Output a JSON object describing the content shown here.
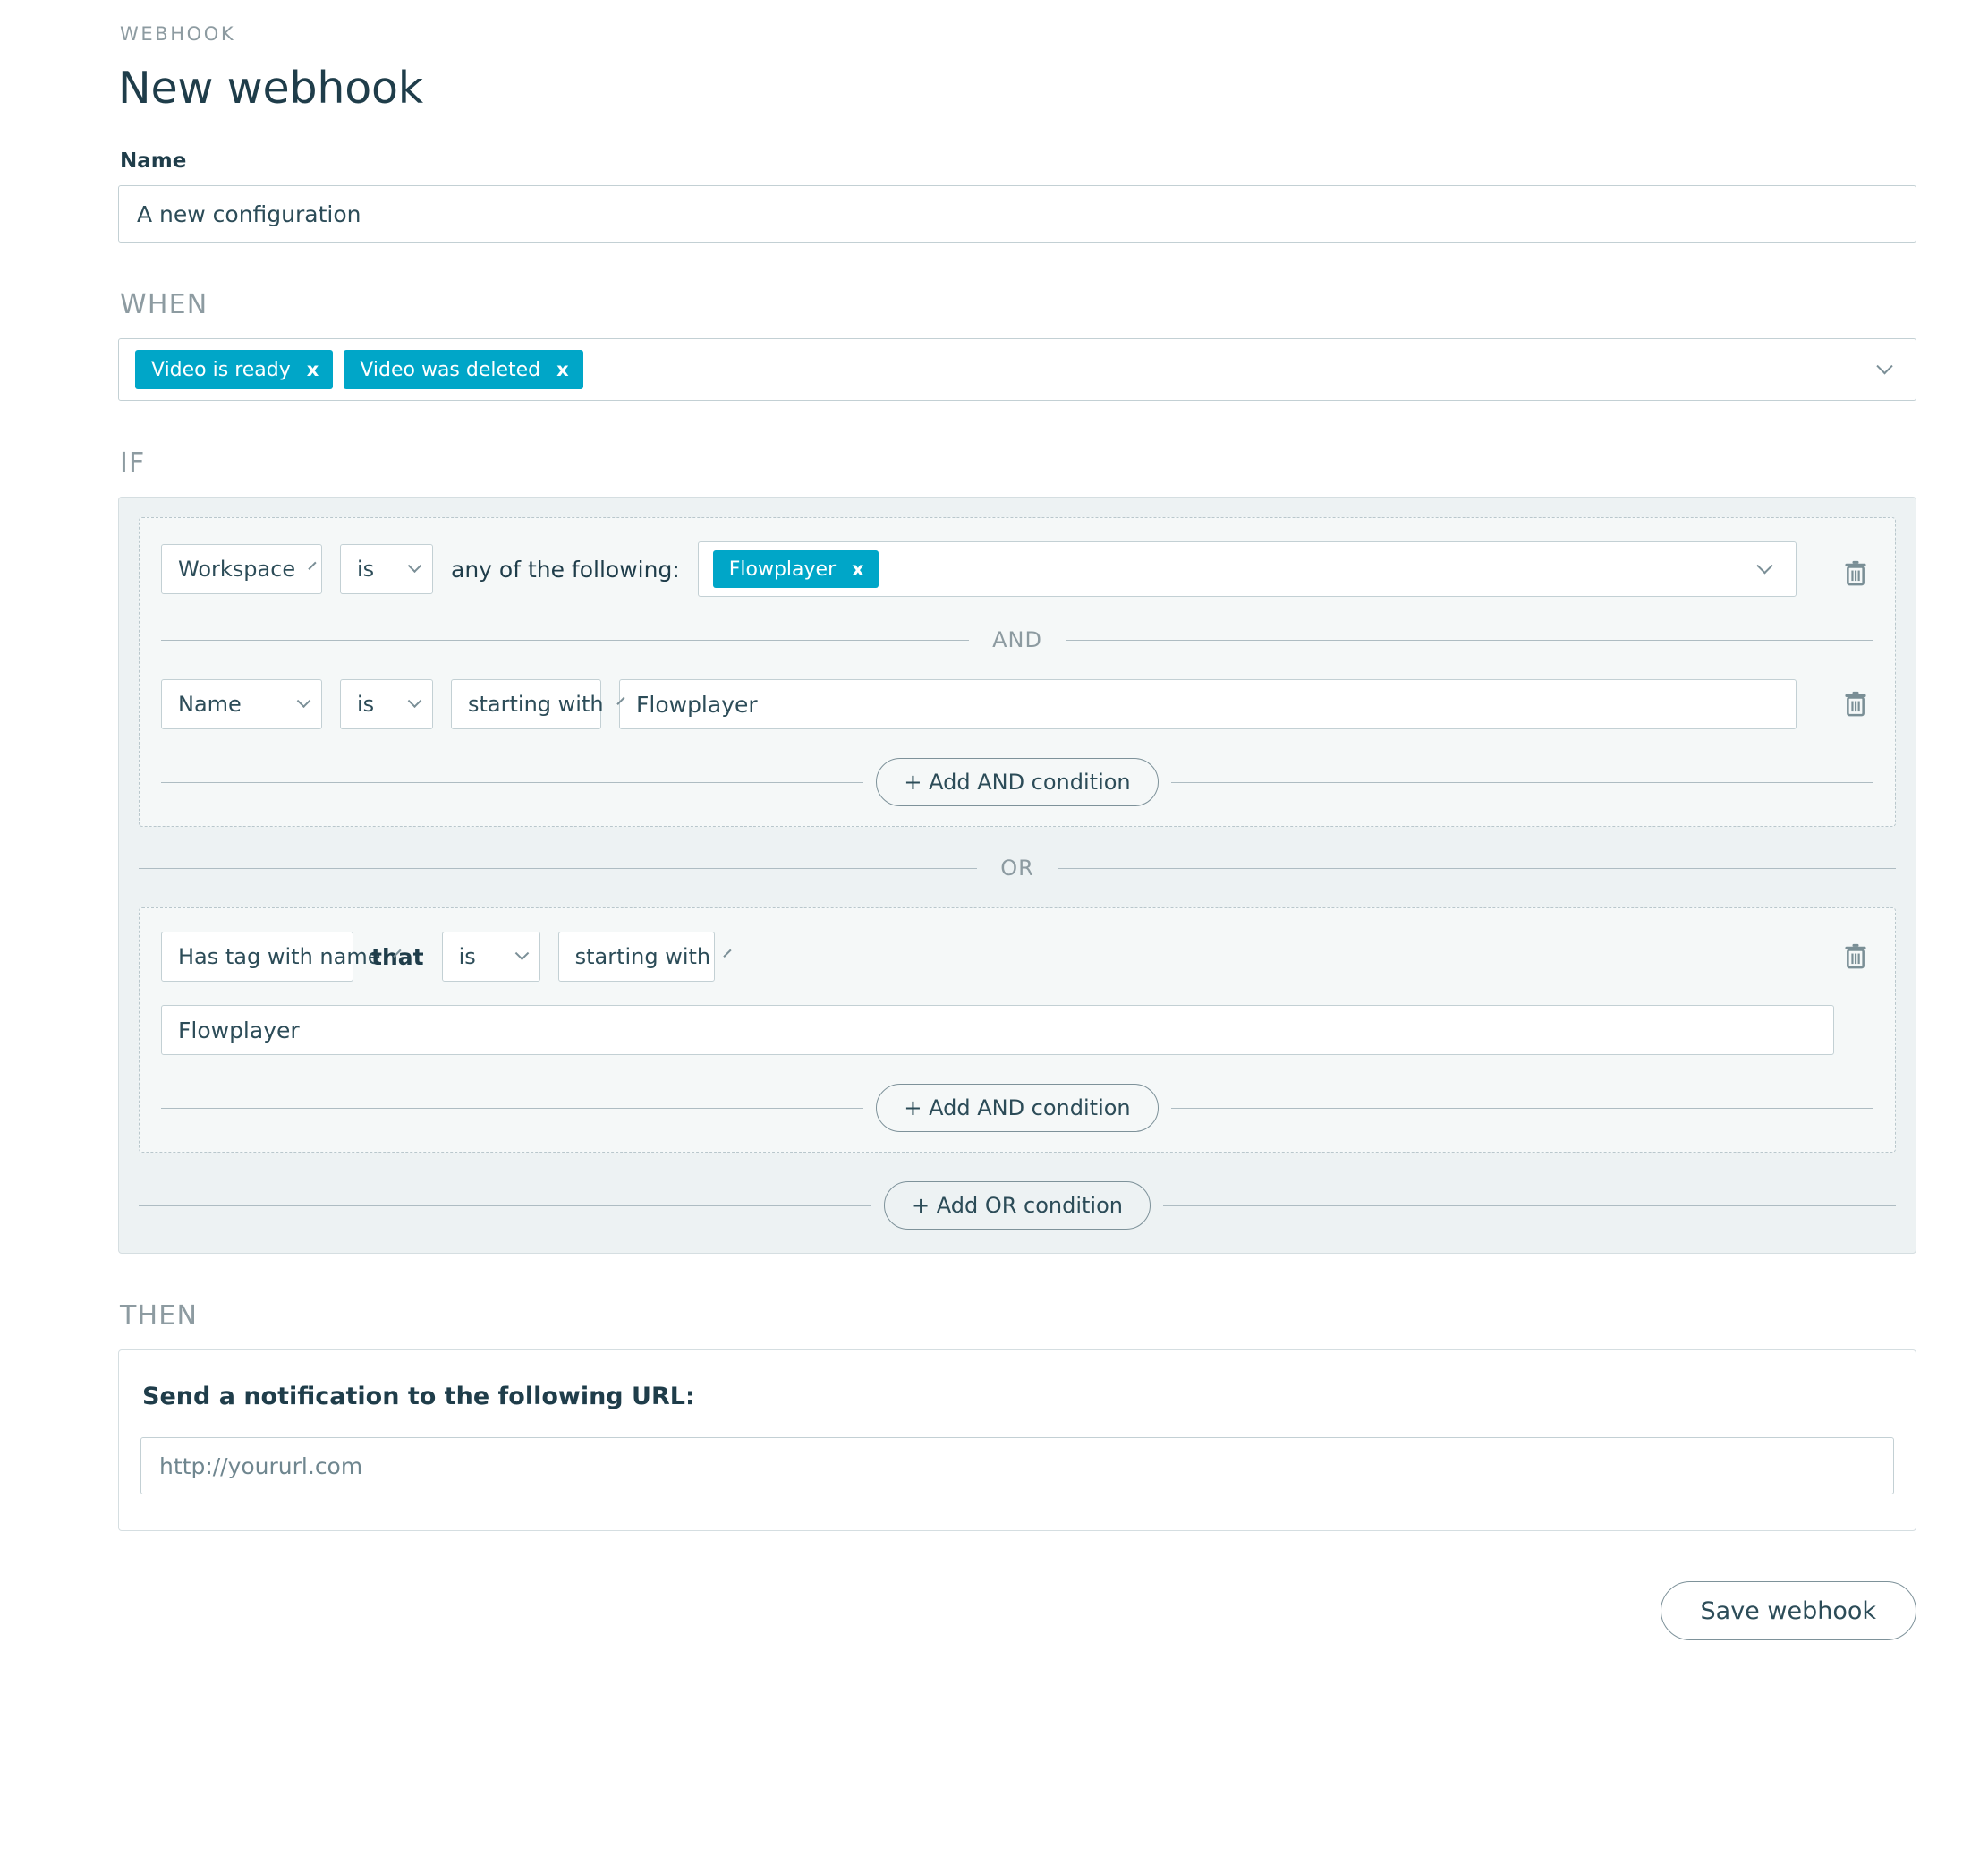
{
  "header": {
    "eyebrow": "WEBHOOK",
    "title": "New webhook",
    "name_label": "Name",
    "name_value": "A new configuration"
  },
  "when": {
    "label": "WHEN",
    "tags": [
      {
        "label": "Video is ready",
        "remove": "x"
      },
      {
        "label": "Video was deleted",
        "remove": "x"
      }
    ]
  },
  "if": {
    "label": "IF",
    "group_one": {
      "row_one": {
        "field": "Workspace",
        "operator": "is",
        "connector": "any of the following:",
        "tags": [
          {
            "label": "Flowplayer",
            "remove": "x"
          }
        ]
      },
      "and_divider": "AND",
      "row_two": {
        "field": "Name",
        "operator": "is",
        "mode": "starting with",
        "value": "Flowplayer"
      },
      "add_and_label": "+ Add AND condition"
    },
    "or_divider": "OR",
    "group_two": {
      "row_one": {
        "field": "Has tag with name",
        "connector": "that",
        "operator": "is",
        "mode": "starting with"
      },
      "value": "Flowplayer",
      "add_and_label": "+ Add AND condition"
    },
    "add_or_label": "+ Add OR condition"
  },
  "then": {
    "label": "THEN",
    "title": "Send a notification to the following URL:",
    "url_value": "http://yoururl.com"
  },
  "footer": {
    "save_label": "Save webhook"
  },
  "colors": {
    "tag_cyan": "#00a6c8",
    "ink": "#1f3d4a",
    "muted": "#8d9ba1",
    "panel": "#edf2f3"
  }
}
